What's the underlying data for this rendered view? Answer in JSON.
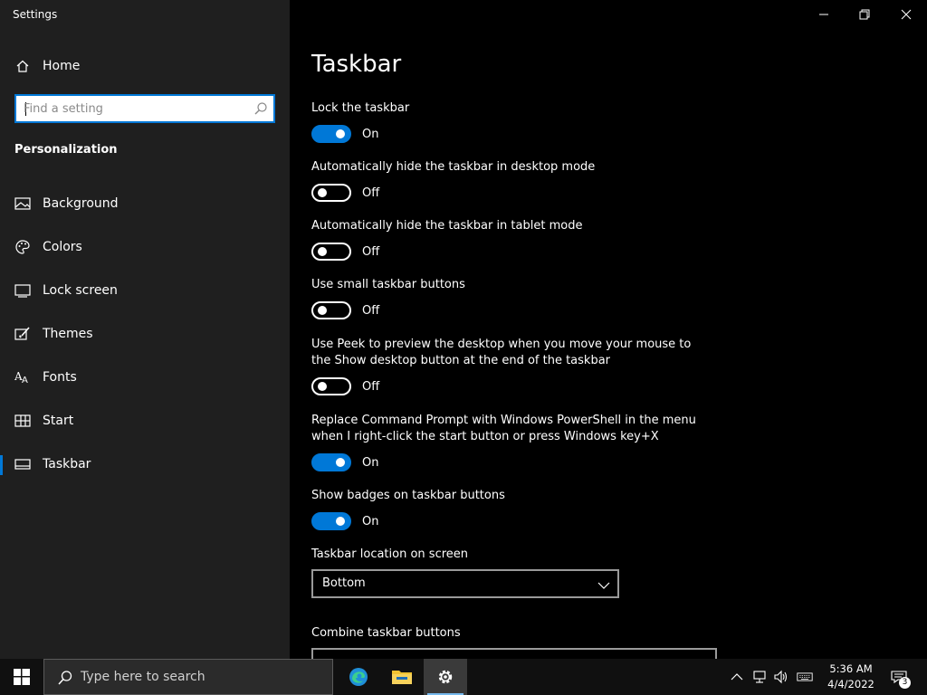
{
  "window": {
    "title": "Settings"
  },
  "sidebar": {
    "home_label": "Home",
    "search_placeholder": "Find a setting",
    "section_heading": "Personalization",
    "items": [
      {
        "label": "Background",
        "icon": "picture-icon"
      },
      {
        "label": "Colors",
        "icon": "palette-icon"
      },
      {
        "label": "Lock screen",
        "icon": "lock-screen-icon"
      },
      {
        "label": "Themes",
        "icon": "brush-icon"
      },
      {
        "label": "Fonts",
        "icon": "fonts-icon"
      },
      {
        "label": "Start",
        "icon": "start-grid-icon"
      },
      {
        "label": "Taskbar",
        "icon": "taskbar-icon",
        "selected": true
      }
    ]
  },
  "main": {
    "title": "Taskbar",
    "settings": [
      {
        "label": "Lock the taskbar",
        "state": "On",
        "on": true
      },
      {
        "label": "Automatically hide the taskbar in desktop mode",
        "state": "Off",
        "on": false
      },
      {
        "label": "Automatically hide the taskbar in tablet mode",
        "state": "Off",
        "on": false
      },
      {
        "label": "Use small taskbar buttons",
        "state": "Off",
        "on": false
      },
      {
        "label": "Use Peek to preview the desktop when you move your mouse to the Show desktop button at the end of the taskbar",
        "state": "Off",
        "on": false
      },
      {
        "label": "Replace Command Prompt with Windows PowerShell in the menu when I right-click the start button or press Windows key+X",
        "state": "On",
        "on": true
      },
      {
        "label": "Show badges on taskbar buttons",
        "state": "On",
        "on": true
      }
    ],
    "location_label": "Taskbar location on screen",
    "location_value": "Bottom",
    "combine_label": "Combine taskbar buttons"
  },
  "taskbar": {
    "search_placeholder": "Type here to search",
    "time": "5:36 AM",
    "date": "4/4/2022",
    "notification_count": "3"
  },
  "colors": {
    "accent": "#0078d7",
    "sidebar_bg": "#1f1f1f",
    "main_bg": "#000000",
    "taskbar_bg": "#101010"
  }
}
